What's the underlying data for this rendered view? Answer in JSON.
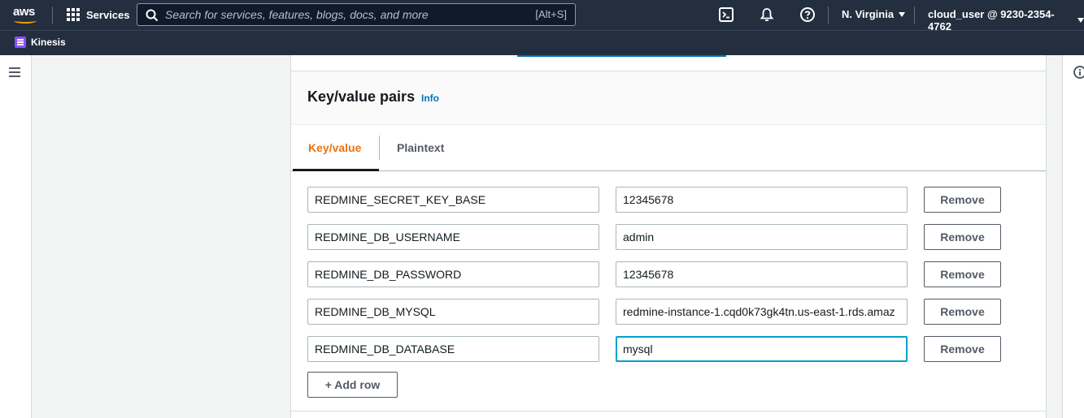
{
  "nav": {
    "logo_text": "aws",
    "services_label": "Services",
    "search_placeholder": "Search for services, features, blogs, docs, and more",
    "search_shortcut": "[Alt+S]",
    "region": "N. Virginia",
    "account": "cloud_user @ 9230-2354-4762"
  },
  "favorites": {
    "items": [
      {
        "label": "Kinesis"
      }
    ]
  },
  "section": {
    "title": "Key/value pairs",
    "info_link": "Info",
    "tabs": [
      {
        "label": "Key/value",
        "active": true
      },
      {
        "label": "Plaintext",
        "active": false
      }
    ]
  },
  "rows": [
    {
      "key": "REDMINE_SECRET_KEY_BASE",
      "value": "12345678",
      "remove_label": "Remove"
    },
    {
      "key": "REDMINE_DB_USERNAME",
      "value": "admin",
      "remove_label": "Remove"
    },
    {
      "key": "REDMINE_DB_PASSWORD",
      "value": "12345678",
      "remove_label": "Remove"
    },
    {
      "key": "REDMINE_DB_MYSQL",
      "value": "redmine-instance-1.cqd0k73gk4tn.us-east-1.rds.amaz",
      "remove_label": "Remove"
    },
    {
      "key": "REDMINE_DB_DATABASE",
      "value": "mysql",
      "remove_label": "Remove"
    }
  ],
  "add_row_label": "+ Add row",
  "colors": {
    "nav_bg": "#232f3e",
    "active_tab": "#ec7211",
    "link": "#0073bb",
    "focus": "#00a1c9"
  }
}
